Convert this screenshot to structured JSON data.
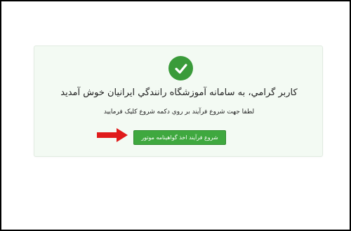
{
  "colors": {
    "card_background": "#f3faf3",
    "success_green": "#3a9b3a",
    "button_green": "#3fa83f",
    "annotation_arrow": "#e01b1b",
    "frame_border": "#000000"
  },
  "icons": {
    "status": "checkmark-circle-icon",
    "annotation": "arrow-right-icon"
  },
  "welcome": {
    "title": "کاربر گرامي، به سامانه آموزشگاه رانندگي ايرانيان خوش آمديد",
    "instruction": "لطفا جهت شروع فرآيند بر روي دکمه شروع کليک فرماييد"
  },
  "actions": {
    "start_label": "شروع فرآيند اخذ گواهينامه موتور"
  }
}
